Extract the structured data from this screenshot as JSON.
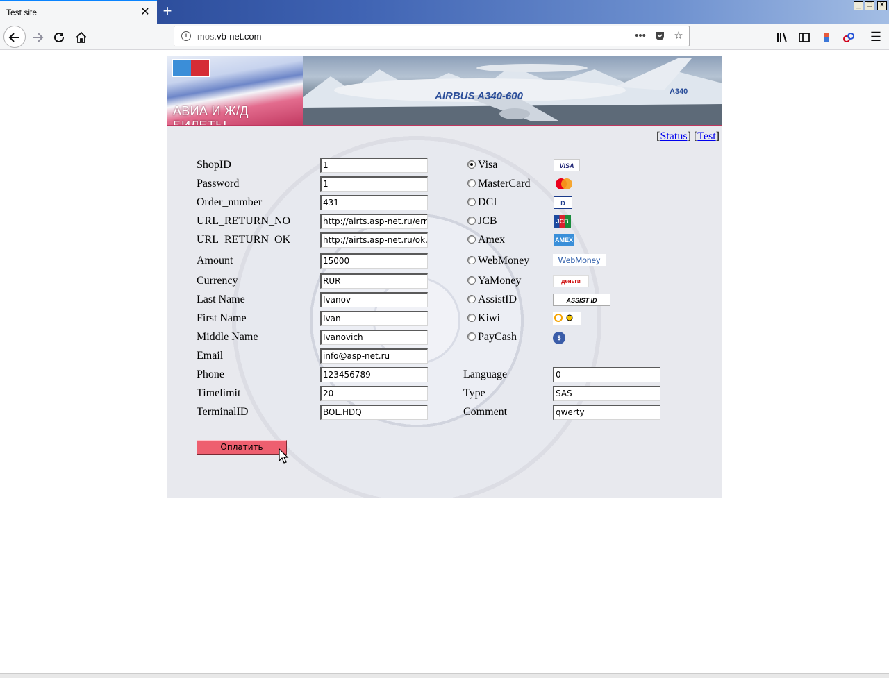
{
  "browser": {
    "tab_title": "Test site",
    "tab_close": "✕",
    "new_tab": "+",
    "url_host_prefix": "mos.",
    "url_host_main": "vb-net.com",
    "window_buttons": [
      "_",
      "❐",
      "✕"
    ]
  },
  "header": {
    "banner_text": "АВИА И Ж/Д БИЛЕТЫ",
    "plane_caption": "AIRBUS A340-600",
    "tail_text": "A340"
  },
  "links": {
    "status": "Status",
    "test": "Test",
    "open_bracket": "[",
    "close_bracket": "]"
  },
  "fields": [
    {
      "label": "ShopID",
      "value": "1"
    },
    {
      "label": "Password",
      "value": "1"
    },
    {
      "label": "Order_number",
      "value": "431"
    },
    {
      "label": "URL_RETURN_NO",
      "value": "http://airts.asp-net.ru/err."
    },
    {
      "label": "URL_RETURN_OK",
      "value": "http://airts.asp-net.ru/ok.a"
    },
    {
      "label": "Amount",
      "value": "15000"
    },
    {
      "label": "Currency",
      "value": "RUR"
    },
    {
      "label": "Last Name",
      "value": "Ivanov"
    },
    {
      "label": "First Name",
      "value": "Ivan"
    },
    {
      "label": "Middle Name",
      "value": "Ivanovich"
    },
    {
      "label": "Email",
      "value": "info@asp-net.ru"
    },
    {
      "label": "Phone",
      "value": "123456789"
    },
    {
      "label": "Timelimit",
      "value": "20"
    },
    {
      "label": "TerminalID",
      "value": "BOL.HDQ"
    }
  ],
  "payment_methods": [
    {
      "label": "Visa",
      "checked": true,
      "logo": "VISA"
    },
    {
      "label": "MasterCard",
      "checked": false,
      "logo": ""
    },
    {
      "label": "DCI",
      "checked": false,
      "logo": "D"
    },
    {
      "label": "JCB",
      "checked": false,
      "logo": "JCB"
    },
    {
      "label": "Amex",
      "checked": false,
      "logo": "AMEX"
    },
    {
      "label": "WebMoney",
      "checked": false,
      "logo": "WebMoney"
    },
    {
      "label": "YaMoney",
      "checked": false,
      "logo": "деньги"
    },
    {
      "label": "AssistID",
      "checked": false,
      "logo": "ASSIST ID"
    },
    {
      "label": "Kiwi",
      "checked": false,
      "logo": ""
    },
    {
      "label": "PayCash",
      "checked": false,
      "logo": "$"
    }
  ],
  "extra_fields": [
    {
      "label": "Language",
      "value": "0"
    },
    {
      "label": "Type",
      "value": "SAS"
    },
    {
      "label": "Comment",
      "value": "qwerty"
    }
  ],
  "pay_button": "Оплатить"
}
